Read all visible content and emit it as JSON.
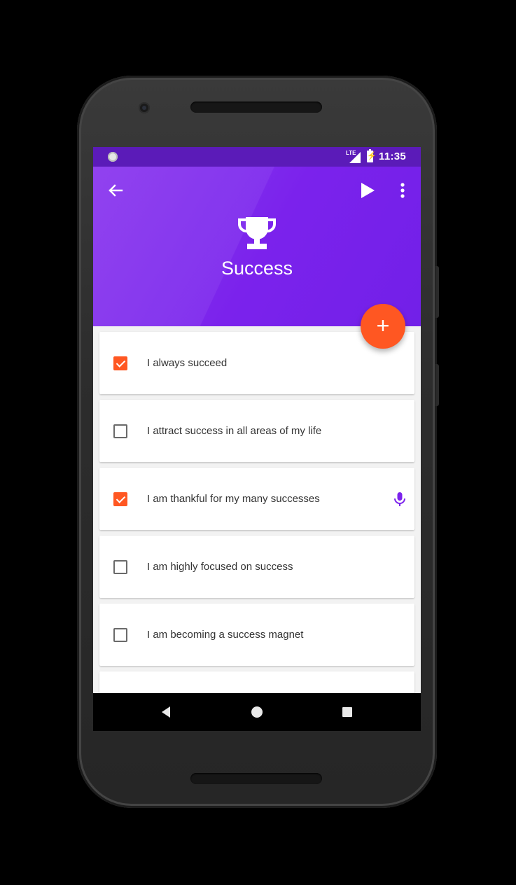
{
  "status_bar": {
    "network": "LTE",
    "time": "11:35"
  },
  "app_bar": {
    "title": "Success"
  },
  "affirmations": [
    {
      "text": "I always succeed",
      "checked": true,
      "has_mic": false
    },
    {
      "text": "I attract success in all areas of my life",
      "checked": false,
      "has_mic": false
    },
    {
      "text": "I am thankful for my many successes",
      "checked": true,
      "has_mic": true
    },
    {
      "text": "I am highly focused on success",
      "checked": false,
      "has_mic": false
    },
    {
      "text": "I am becoming a success magnet",
      "checked": false,
      "has_mic": false
    }
  ],
  "fab": {
    "label": "+"
  },
  "icons": {
    "back": "arrow-back-icon",
    "play": "play-icon",
    "more": "more-vert-icon",
    "trophy": "trophy-icon",
    "mic": "microphone-icon",
    "add": "add-icon"
  },
  "colors": {
    "primary": "#7b22ec",
    "status_bar": "#5b1bb8",
    "accent": "#ff5722",
    "mic": "#7b22ec"
  }
}
